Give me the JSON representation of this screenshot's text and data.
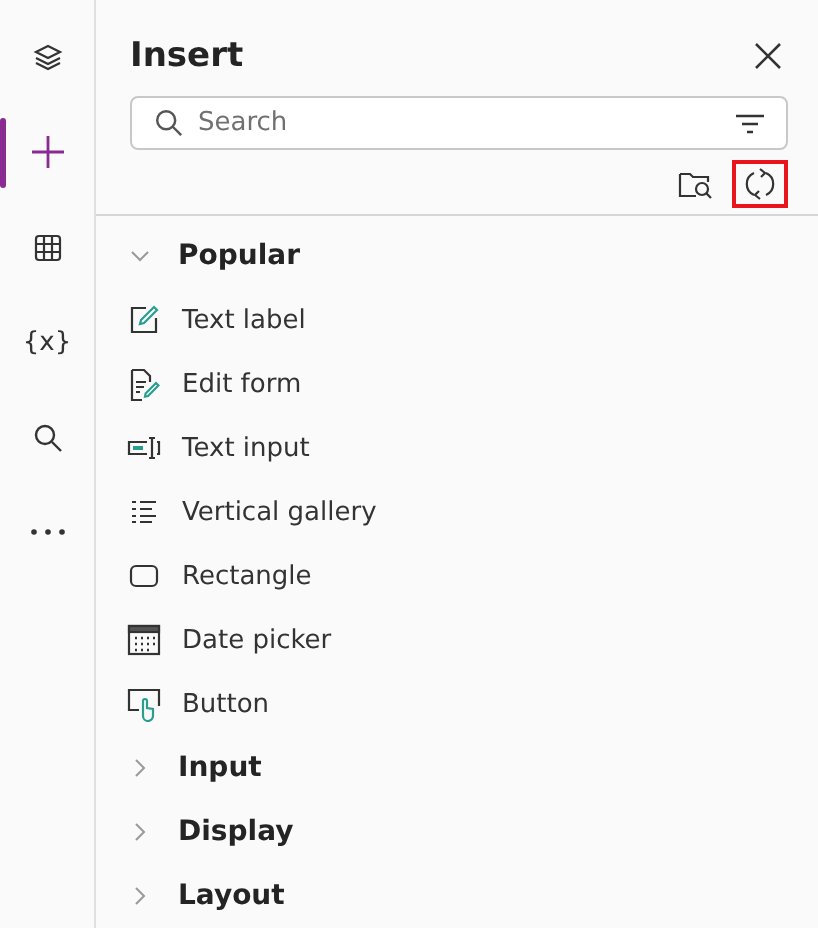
{
  "rail": [
    {
      "kind": "layers",
      "selected": false
    },
    {
      "kind": "plus",
      "selected": true
    },
    {
      "kind": "table",
      "selected": false
    },
    {
      "kind": "variables",
      "label": "{x}",
      "selected": false
    },
    {
      "kind": "search",
      "selected": false
    },
    {
      "kind": "more",
      "selected": false
    }
  ],
  "panel": {
    "title": "Insert",
    "search": {
      "placeholder": "Search"
    },
    "tools": [
      {
        "kind": "folder-search",
        "highlighted": false
      },
      {
        "kind": "refresh",
        "highlighted": true
      }
    ],
    "categories": [
      {
        "label": "Popular",
        "expanded": true,
        "items": [
          {
            "label": "Text label",
            "kind": "text-label"
          },
          {
            "label": "Edit form",
            "kind": "edit-form"
          },
          {
            "label": "Text input",
            "kind": "text-input"
          },
          {
            "label": "Vertical gallery",
            "kind": "gallery"
          },
          {
            "label": "Rectangle",
            "kind": "rectangle"
          },
          {
            "label": "Date picker",
            "kind": "date-picker"
          },
          {
            "label": "Button",
            "kind": "button"
          }
        ]
      },
      {
        "label": "Input",
        "expanded": false
      },
      {
        "label": "Display",
        "expanded": false
      },
      {
        "label": "Layout",
        "expanded": false
      }
    ]
  }
}
